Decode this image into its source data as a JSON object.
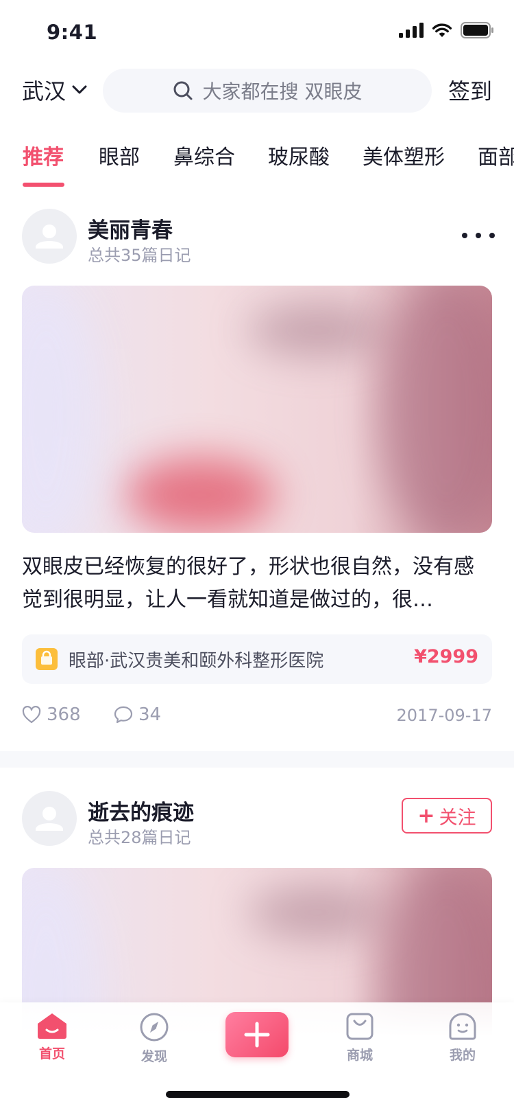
{
  "status_bar": {
    "time": "9:41",
    "icons": [
      "cellular-signal-icon",
      "wifi-icon",
      "battery-icon"
    ]
  },
  "header": {
    "city": "武汉",
    "search_placeholder": "大家都在搜 双眼皮",
    "checkin_label": "签到"
  },
  "tabs": [
    "推荐",
    "眼部",
    "鼻综合",
    "玻尿酸",
    "美体塑形",
    "面部"
  ],
  "active_tab": 0,
  "posts": [
    {
      "author": "美丽青春",
      "diary_count": "总共35篇日记",
      "caption": "双眼皮已经恢复的很好了，形状也很自然，没有感觉到很明显，让人一看就知道是做过的，很…",
      "product": "眼部·武汉贵美和颐外科整形医院",
      "price": "¥2999",
      "likes": "368",
      "comments": "34",
      "date": "2017-09-17"
    },
    {
      "author": "逝去的痕迹",
      "diary_count": "总共28篇日记",
      "follow_label": "关注"
    }
  ],
  "tabbar": {
    "items": [
      {
        "label": "首页",
        "icon": "home-icon"
      },
      {
        "label": "发现",
        "icon": "compass-icon"
      },
      {
        "label": "商城",
        "icon": "shopping-bag-icon"
      },
      {
        "label": "我的",
        "icon": "profile-face-icon"
      }
    ],
    "publish_icon": "plus-icon",
    "active_index": 0
  },
  "colors": {
    "accent": "#f2506e",
    "text": "#1b1c2a",
    "muted": "#9b9db0",
    "surface": "#f6f7fb",
    "bag": "#fcbe3b"
  }
}
